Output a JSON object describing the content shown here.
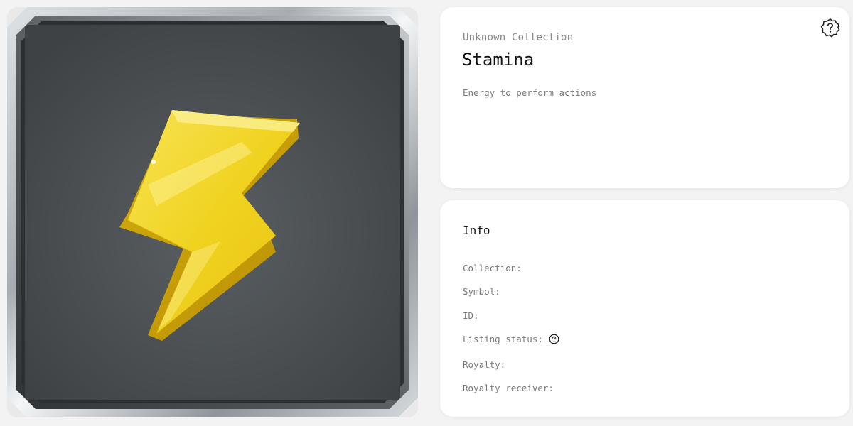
{
  "item": {
    "collection": "Unknown Collection",
    "name": "Stamina",
    "description": "Energy to perform actions",
    "image_icon": "lightning-bolt-icon",
    "help_icon": "help-badge-icon"
  },
  "info": {
    "title": "Info",
    "rows": [
      {
        "label": "Collection:"
      },
      {
        "label": "Symbol:"
      },
      {
        "label": "ID:"
      },
      {
        "label": "Listing status:",
        "help_icon": "question-circle-icon"
      },
      {
        "label": "Royalty:"
      },
      {
        "label": "Royalty receiver:"
      }
    ]
  },
  "colors": {
    "page_bg": "#f3f3f3",
    "card_bg": "#ffffff",
    "frame_inner": "#45494c",
    "bolt_yellow": "#f2d624"
  }
}
